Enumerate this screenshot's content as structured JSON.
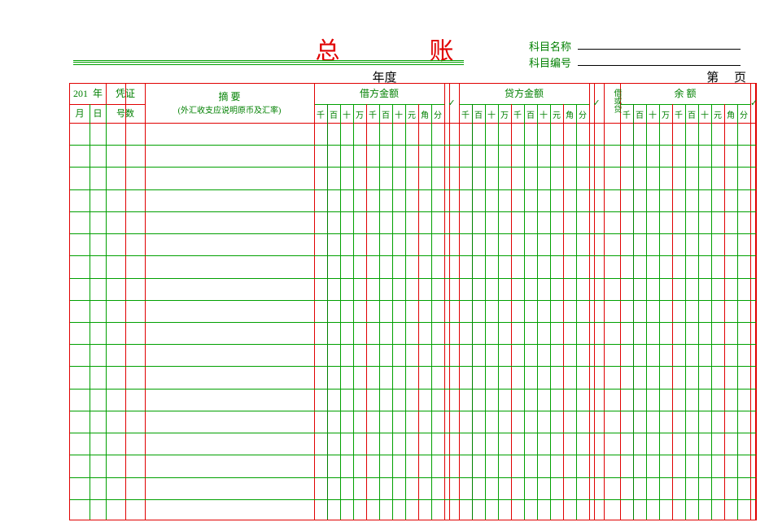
{
  "title": "总账",
  "year_label": "年度",
  "subject_name_label": "科目名称",
  "subject_code_label": "科目编号",
  "page_label_prefix": "第",
  "page_label_suffix": "页",
  "header": {
    "year_prefix": "201",
    "year_suffix": "年",
    "voucher": "凭证",
    "month": "月",
    "day": "日",
    "voucher_no": "号数",
    "summary": "摘    要",
    "summary_note": "(外汇收支应说明原币及汇率)",
    "debit": "借方金额",
    "credit": "贷方金额",
    "check": "✓",
    "direction": "借或贷",
    "balance": "余    额",
    "digits": [
      "千",
      "百",
      "十",
      "万",
      "千",
      "百",
      "十",
      "元",
      "角",
      "分"
    ]
  },
  "rows": 18,
  "colors": {
    "red": "#e00000",
    "green": "#00a000",
    "dark_green": "#008000"
  }
}
